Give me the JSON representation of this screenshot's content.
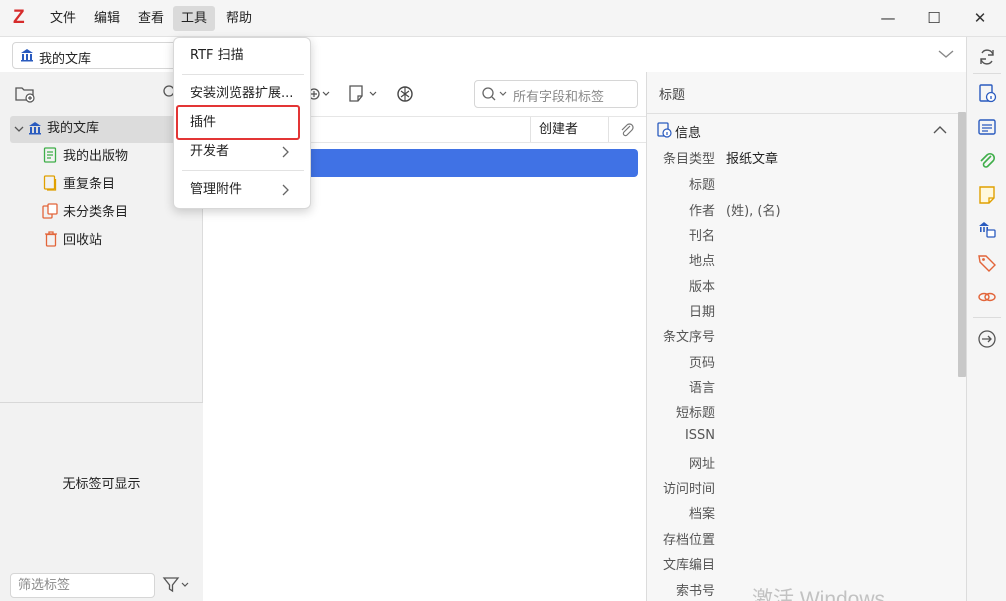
{
  "app": {
    "logo": "Z",
    "menus": [
      "文件",
      "编辑",
      "查看",
      "工具",
      "帮助"
    ],
    "window_controls": {
      "minimize": "—",
      "maximize": "☐",
      "close": "✕"
    }
  },
  "library_selector": {
    "label": "我的文库"
  },
  "collections": {
    "root": "我的文库",
    "children": [
      "我的出版物",
      "重复条目",
      "未分类条目",
      "回收站"
    ]
  },
  "tags": {
    "empty_text": "无标签可显示",
    "filter_placeholder": "筛选标签"
  },
  "items": {
    "search_placeholder": "所有字段和标签",
    "columns": {
      "creator": "创建者"
    }
  },
  "tools_menu": {
    "items": [
      {
        "label": "RTF 扫描"
      },
      {
        "label": "安装浏览器扩展..."
      },
      {
        "label": "插件",
        "highlighted": true
      },
      {
        "label": "开发者",
        "submenu": true
      },
      {
        "label": "管理附件",
        "submenu": true
      }
    ],
    "highlight_color": "#e33535"
  },
  "item_pane": {
    "header": "标题",
    "section_title": "信息",
    "fields": [
      {
        "label": "条目类型",
        "value": "报纸文章"
      },
      {
        "label": "标题",
        "value": ""
      },
      {
        "label": "作者",
        "value": "(姓), (名)"
      },
      {
        "label": "刊名",
        "value": ""
      },
      {
        "label": "地点",
        "value": ""
      },
      {
        "label": "版本",
        "value": ""
      },
      {
        "label": "日期",
        "value": ""
      },
      {
        "label": "条文序号",
        "value": ""
      },
      {
        "label": "页码",
        "value": ""
      },
      {
        "label": "语言",
        "value": ""
      },
      {
        "label": "短标题",
        "value": ""
      },
      {
        "label": "ISSN",
        "value": ""
      },
      {
        "label": "网址",
        "value": ""
      },
      {
        "label": "访问时间",
        "value": ""
      },
      {
        "label": "档案",
        "value": ""
      },
      {
        "label": "存档位置",
        "value": ""
      },
      {
        "label": "文库编目",
        "value": ""
      },
      {
        "label": "索书号",
        "value": ""
      }
    ]
  },
  "watermark": "激活 Windows",
  "colors": {
    "accent": "#4072e5",
    "logo": "#d62b2b"
  }
}
